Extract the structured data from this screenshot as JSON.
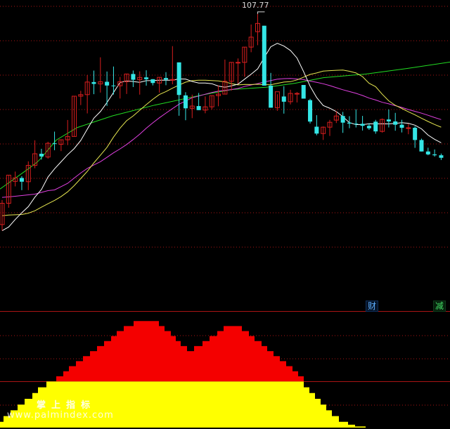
{
  "chart_data": [
    {
      "type": "candlestick",
      "peak_label": "107.77",
      "colors": {
        "up": "#d81e1e",
        "down": "#34e6e6",
        "ma5": "#ffffff",
        "ma10": "#e6e650",
        "ma20": "#e040e0",
        "ma60": "#22dd22",
        "grid": "#aa1515"
      },
      "candles": [
        [
          46.56,
          53.7,
          44.83,
          52.75
        ],
        [
          52.75,
          60.93,
          51.46,
          60.93
        ],
        [
          59.11,
          61.97,
          57.66,
          60.14
        ],
        [
          60.11,
          60.63,
          56.57,
          59.02
        ],
        [
          59.02,
          64.93,
          56.57,
          63.76
        ],
        [
          63.76,
          71.07,
          62.93,
          67.15
        ],
        [
          67.15,
          68.59,
          65.45,
          66.36
        ],
        [
          66.19,
          70.63,
          65.72,
          70.18
        ],
        [
          70.18,
          73.58,
          68.18,
          70.07
        ],
        [
          69.88,
          71.21,
          67.92,
          71.21
        ],
        [
          71.21,
          76.96,
          69.65,
          72.17
        ],
        [
          72.17,
          83.88,
          72.17,
          83.88
        ],
        [
          83.88,
          85.44,
          81.29,
          84.33
        ],
        [
          84.33,
          90.02,
          78.88,
          87.99
        ],
        [
          87.99,
          91.32,
          84.46,
          87.44
        ],
        [
          87.44,
          95.18,
          84.93,
          88.06
        ],
        [
          88.06,
          91.05,
          81.05,
          86.98
        ],
        [
          86.98,
          92.5,
          84.33,
          86.91
        ],
        [
          86.91,
          89.46,
          83.2,
          88.09
        ],
        [
          88.09,
          90.33,
          84.52,
          90.33
        ],
        [
          90.33,
          91.34,
          86.54,
          88.66
        ],
        [
          88.66,
          91.1,
          84.33,
          89.34
        ],
        [
          89.34,
          91.41,
          86.94,
          88.82
        ],
        [
          88.82,
          88.82,
          87.02,
          87.71
        ],
        [
          87.71,
          89.36,
          84.91,
          89.36
        ],
        [
          89.16,
          90.88,
          87.06,
          88.72
        ],
        [
          88.72,
          98.43,
          87.33,
          88.73
        ],
        [
          93.71,
          93.71,
          78.2,
          84.23
        ],
        [
          84.11,
          85.04,
          76.89,
          80.35
        ],
        [
          80.35,
          84.33,
          77.5,
          81.01
        ],
        [
          81.01,
          84.82,
          79.83,
          79.83
        ],
        [
          79.83,
          83.8,
          78.91,
          80.78
        ],
        [
          80.78,
          84.04,
          80.03,
          84.04
        ],
        [
          84.04,
          87.07,
          80.95,
          84.48
        ],
        [
          84.48,
          94.52,
          84.48,
          88.22
        ],
        [
          88.22,
          93.71,
          85.52,
          93.71
        ],
        [
          93.71,
          94.85,
          87.51,
          93.71
        ],
        [
          93.71,
          98.14,
          89.5,
          98.14
        ],
        [
          98.14,
          104.72,
          96.66,
          101.04
        ],
        [
          102.63,
          107.77,
          98.7,
          105.03
        ],
        [
          104.36,
          104.36,
          97.32,
          86.95
        ],
        [
          86.95,
          90.65,
          80.54,
          80.54
        ],
        [
          80.54,
          84.44,
          79.63,
          85.16
        ],
        [
          83.79,
          86.78,
          78.81,
          82.27
        ],
        [
          82.27,
          85.74,
          81.48,
          84.68
        ],
        [
          84.68,
          85.08,
          82.06,
          84.68
        ],
        [
          87.14,
          87.14,
          83.49,
          83.17
        ],
        [
          82.73,
          83.12,
          75.95,
          76.5
        ],
        [
          75.01,
          78.36,
          72.52,
          73.01
        ],
        [
          73.01,
          75.07,
          71.16,
          74.87
        ],
        [
          74.87,
          76.99,
          72.33,
          76.29
        ],
        [
          76.92,
          79.55,
          76.08,
          78.12
        ],
        [
          78.12,
          79.32,
          73.22,
          76.19
        ],
        [
          76.19,
          78.06,
          74.57,
          75.9
        ],
        [
          75.9,
          80.07,
          74.79,
          75.85
        ],
        [
          75.85,
          78.15,
          73.9,
          75.27
        ],
        [
          75.27,
          76.01,
          74.08,
          74.55
        ],
        [
          76.47,
          77.0,
          72.97,
          73.64
        ],
        [
          73.64,
          77.4,
          73.3,
          77.11
        ],
        [
          77.11,
          80.03,
          74.79,
          76.54
        ],
        [
          76.54,
          79.03,
          73.84,
          75.58
        ],
        [
          75.58,
          77.02,
          73.34,
          74.7
        ],
        [
          74.7,
          75.92,
          72.82,
          74.7
        ],
        [
          74.7,
          75.13,
          68.86,
          71.14
        ],
        [
          71.14,
          71.53,
          67.81,
          67.81
        ],
        [
          67.81,
          68.9,
          66.71,
          66.96
        ],
        [
          66.96,
          68.39,
          66.32,
          66.71
        ],
        [
          66.71,
          67.2,
          65.34,
          65.97
        ]
      ],
      "moving_averages": {
        "ma5": [
          44.78,
          45.86,
          48.03,
          49.99,
          51.77,
          54.53,
          56.73,
          60.37,
          62.77,
          64.82,
          66.87,
          68.65,
          71.01,
          74.31,
          77.5,
          79.41,
          82.03,
          84.93,
          87.87,
          88.33,
          88.14,
          87.92,
          88.38,
          88.41,
          88.53,
          88.55,
          88.52,
          88.89,
          88.85,
          88.16,
          87.71,
          87.71,
          87.52,
          86.82,
          86.47,
          86.89,
          87.37,
          88.82,
          90.29,
          91.84,
          95.11,
          98.24,
          99.25,
          98.44,
          97.17,
          94.97,
          91.06,
          86.79,
          83.47,
          81.16,
          80.38,
          79.4,
          77.93,
          76.18,
          75.63,
          75.59,
          75.85,
          75.84,
          75.88,
          75.83,
          75.96,
          76.19,
          75.99,
          75.44,
          74.38,
          72.58,
          71.35,
          70.35
        ],
        "ma10": [
          49.15,
          49.35,
          49.4,
          49.49,
          49.88,
          50.58,
          51.62,
          52.62,
          53.6,
          54.72,
          56.09,
          57.87,
          59.91,
          62.04,
          64.48,
          66.72,
          69.01,
          71.97,
          74.62,
          76.76,
          78.14,
          79.79,
          81.43,
          82.97,
          84.37,
          85.23,
          86.2,
          87.1,
          87.96,
          88.39,
          88.53,
          88.53,
          88.41,
          88.32,
          88.02,
          87.54,
          87.17,
          87.29,
          87.26,
          87.34,
          87.22,
          87.2,
          87.61,
          87.98,
          88.11,
          88.62,
          89.4,
          90.2,
          90.64,
          91.16,
          91.31,
          91.41,
          91.47,
          91.13,
          90.64,
          89.57,
          87.64,
          86.66,
          84.44,
          82.54,
          81.22,
          80.3,
          79.34,
          78.44,
          77.46,
          76.53,
          75.65,
          74.87
        ],
        "ma20": [
          54.47,
          54.62,
          54.8,
          54.99,
          55.21,
          55.4,
          55.92,
          56.42,
          56.64,
          57.6,
          58.55,
          60.08,
          61.56,
          62.87,
          63.89,
          64.84,
          66.1,
          67.41,
          68.58,
          69.84,
          71.29,
          72.83,
          74.57,
          76.15,
          77.61,
          78.95,
          80.26,
          81.55,
          82.5,
          83.42,
          83.92,
          84.44,
          84.95,
          85.34,
          85.55,
          85.81,
          86.12,
          86.7,
          87.14,
          87.54,
          88.0,
          88.43,
          88.84,
          88.98,
          89.04,
          88.88,
          88.69,
          88.26,
          87.89,
          87.5,
          86.96,
          86.35,
          85.76,
          85.22,
          84.72,
          84.09,
          83.32,
          82.78,
          82.1,
          81.66,
          81.12,
          80.62,
          80.0,
          79.47,
          78.93,
          78.32,
          77.67,
          77.09
        ]
      },
      "ma60": [
        [
          0,
          56.9
        ],
        [
          40,
          62.71
        ],
        [
          53,
          64.74
        ],
        [
          58,
          65.77
        ],
        [
          80,
          71.12
        ],
        [
          110,
          74.77
        ],
        [
          160,
          78.16
        ],
        [
          220,
          81.28
        ],
        [
          290,
          84.34
        ],
        [
          330,
          85.82
        ],
        [
          380,
          86.52
        ],
        [
          420,
          87.66
        ],
        [
          460,
          89.27
        ],
        [
          520,
          90.3
        ],
        [
          580,
          91.95
        ],
        [
          640,
          93.8
        ]
      ],
      "y_axis": [
        40,
        110
      ]
    },
    {
      "type": "area",
      "series": [
        {
          "color": "#f40000",
          "steps": [
            [
              0,
              0
            ],
            [
              80,
              1
            ],
            [
              90,
              2
            ],
            [
              98,
              3
            ],
            [
              108,
              4
            ],
            [
              118,
              5
            ],
            [
              128,
              6
            ],
            [
              138,
              7
            ],
            [
              148,
              8
            ],
            [
              158,
              9
            ],
            [
              166,
              10
            ],
            [
              176,
              11
            ],
            [
              190,
              12
            ],
            [
              226,
              11
            ],
            [
              234,
              10
            ],
            [
              243,
              9
            ],
            [
              250,
              8
            ],
            [
              257,
              7
            ],
            [
              266,
              6
            ],
            [
              276,
              7
            ],
            [
              288,
              8
            ],
            [
              298,
              9
            ],
            [
              309,
              10
            ],
            [
              318,
              11
            ],
            [
              344,
              10
            ],
            [
              354,
              9
            ],
            [
              362,
              8
            ],
            [
              372,
              7
            ],
            [
              380,
              6
            ],
            [
              389,
              5
            ],
            [
              398,
              4
            ],
            [
              407,
              3
            ],
            [
              416,
              2
            ],
            [
              424,
              1
            ],
            [
              432,
              0
            ]
          ]
        },
        {
          "color": "#ffff00",
          "steps": [
            [
              0,
              1
            ],
            [
              5,
              2
            ],
            [
              15,
              3
            ],
            [
              25,
              4
            ],
            [
              35,
              5
            ],
            [
              46,
              6
            ],
            [
              54,
              7
            ],
            [
              66,
              8
            ],
            [
              432,
              7
            ],
            [
              440,
              6
            ],
            [
              448,
              5
            ],
            [
              456,
              4
            ],
            [
              464,
              3
            ],
            [
              472,
              2
            ],
            [
              482,
              1
            ],
            [
              495,
              0.5
            ],
            [
              505,
              0.2
            ],
            [
              520,
              0
            ]
          ]
        }
      ],
      "labels": {
        "badge_1": "财",
        "badge_2": "减"
      },
      "watermark": {
        "cn": "掌上指标",
        "url": "www.palmindex.com"
      }
    }
  ]
}
